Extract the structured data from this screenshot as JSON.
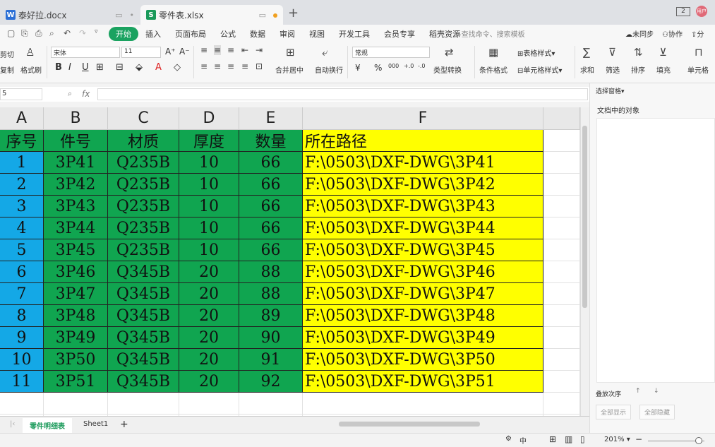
{
  "tabs": [
    {
      "name": "泰好拉.docx",
      "type": "W"
    },
    {
      "name": "零件表.xlsx",
      "type": "S"
    }
  ],
  "window": {
    "zoom_badge": "2",
    "avatar_text": "用户"
  },
  "menu": {
    "items": [
      "开始",
      "插入",
      "页面布局",
      "公式",
      "数据",
      "审阅",
      "视图",
      "开发工具",
      "会员专享",
      "稻壳资源"
    ],
    "search_placeholder": "查找命令、搜索模板",
    "collab": [
      "未同步",
      "协作",
      "分"
    ]
  },
  "ribbon": {
    "cut": "剪切",
    "copy": "复制",
    "format_painter": "格式刷",
    "font_name": "宋体",
    "font_size": "11",
    "merge": "合并居中",
    "wrap": "自动换行",
    "number_format": "常规",
    "type_convert": "类型转换",
    "cond_format": "条件格式",
    "table_style": "表格样式",
    "cell_style": "单元格样式",
    "sum": "求和",
    "filter": "筛选",
    "sort": "排序",
    "fill": "填充",
    "cell": "单元格",
    "bold": "B",
    "italic": "I",
    "underline": "U",
    "percent": "%",
    "thousands": "000",
    "yuan": "¥"
  },
  "formula_bar": {
    "name_box": "5",
    "fx": "fx"
  },
  "sheet": {
    "columns": [
      "A",
      "B",
      "C",
      "D",
      "E",
      "F"
    ],
    "header_row": [
      "序号",
      "件号",
      "材质",
      "厚度",
      "数量",
      "所在路径"
    ],
    "rows": [
      [
        "1",
        "3P41",
        "Q235B",
        "10",
        "66",
        "F:\\0503\\DXF-DWG\\3P41"
      ],
      [
        "2",
        "3P42",
        "Q235B",
        "10",
        "66",
        "F:\\0503\\DXF-DWG\\3P42"
      ],
      [
        "3",
        "3P43",
        "Q235B",
        "10",
        "66",
        "F:\\0503\\DXF-DWG\\3P43"
      ],
      [
        "4",
        "3P44",
        "Q235B",
        "10",
        "66",
        "F:\\0503\\DXF-DWG\\3P44"
      ],
      [
        "5",
        "3P45",
        "Q235B",
        "10",
        "66",
        "F:\\0503\\DXF-DWG\\3P45"
      ],
      [
        "6",
        "3P46",
        "Q345B",
        "20",
        "88",
        "F:\\0503\\DXF-DWG\\3P46"
      ],
      [
        "7",
        "3P47",
        "Q345B",
        "20",
        "88",
        "F:\\0503\\DXF-DWG\\3P47"
      ],
      [
        "8",
        "3P48",
        "Q345B",
        "20",
        "89",
        "F:\\0503\\DXF-DWG\\3P48"
      ],
      [
        "9",
        "3P49",
        "Q345B",
        "20",
        "90",
        "F:\\0503\\DXF-DWG\\3P49"
      ],
      [
        "10",
        "3P50",
        "Q345B",
        "20",
        "91",
        "F:\\0503\\DXF-DWG\\3P50"
      ],
      [
        "11",
        "3P51",
        "Q345B",
        "20",
        "92",
        "F:\\0503\\DXF-DWG\\3P51"
      ]
    ],
    "colors": {
      "col_a": "#14a8e6",
      "green": "#10a550",
      "yellow": "#ffff00"
    }
  },
  "sheet_tabs": [
    "零件明细表",
    "Sheet1"
  ],
  "pane": {
    "title": "选择窗格",
    "section": "文档中的对象",
    "order_label": "叠放次序",
    "show_all": "全部显示",
    "hide_all": "全部隐藏"
  },
  "status": {
    "zoom": "201%",
    "input_mode": "中"
  }
}
